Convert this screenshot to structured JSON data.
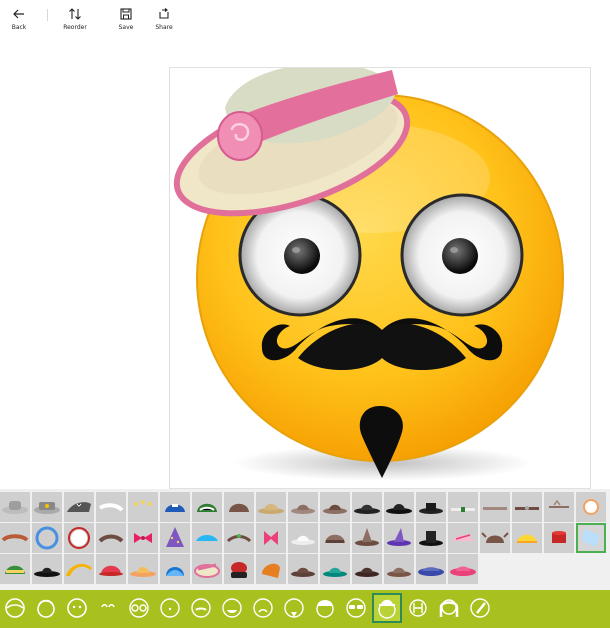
{
  "toolbar": {
    "back_label": "Back",
    "reorder_label": "Reorder",
    "save_label": "Save",
    "share_label": "Share"
  },
  "icons": {
    "back": "arrow-left-icon",
    "reorder": "up-down-arrows-icon",
    "save": "floppy-disk-icon",
    "share": "share-icon"
  },
  "colors": {
    "category_bar": "#a8c11e",
    "selection": "#4caf50",
    "tile": "#cfcfcf",
    "panel": "#f0f0f0"
  },
  "selected_hat_index": 37,
  "selected_category_index": 12
}
